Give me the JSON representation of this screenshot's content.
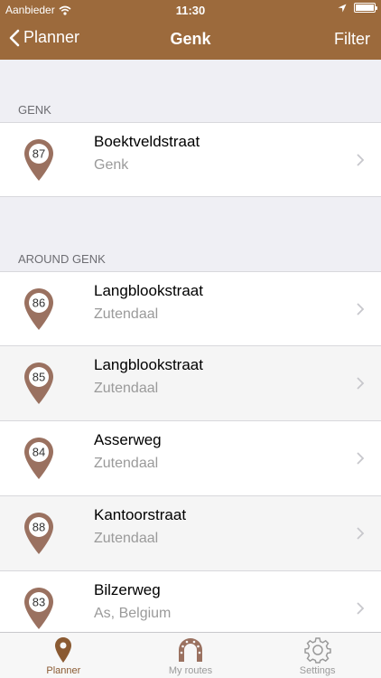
{
  "status_bar": {
    "carrier": "Aanbieder",
    "time": "11:30"
  },
  "nav": {
    "back_label": "Planner",
    "title": "Genk",
    "filter_label": "Filter"
  },
  "colors": {
    "brand": "#9c6a3c",
    "pin": "#9a7160",
    "tab_active": "#8a5a32"
  },
  "sections": [
    {
      "header": "GENK",
      "items": [
        {
          "number": "87",
          "title": "Boektveldstraat",
          "subtitle": "Genk"
        }
      ]
    },
    {
      "header": "AROUND GENK",
      "items": [
        {
          "number": "86",
          "title": "Langblookstraat",
          "subtitle": "Zutendaal"
        },
        {
          "number": "85",
          "title": "Langblookstraat",
          "subtitle": "Zutendaal"
        },
        {
          "number": "84",
          "title": "Asserweg",
          "subtitle": "Zutendaal"
        },
        {
          "number": "88",
          "title": "Kantoorstraat",
          "subtitle": "Zutendaal"
        },
        {
          "number": "83",
          "title": "Bilzerweg",
          "subtitle": "As, Belgium"
        }
      ]
    }
  ],
  "tabs": [
    {
      "label": "Planner",
      "icon": "map-pin-icon",
      "active": true
    },
    {
      "label": "My routes",
      "icon": "horseshoe-icon",
      "active": false
    },
    {
      "label": "Settings",
      "icon": "gear-icon",
      "active": false
    }
  ]
}
